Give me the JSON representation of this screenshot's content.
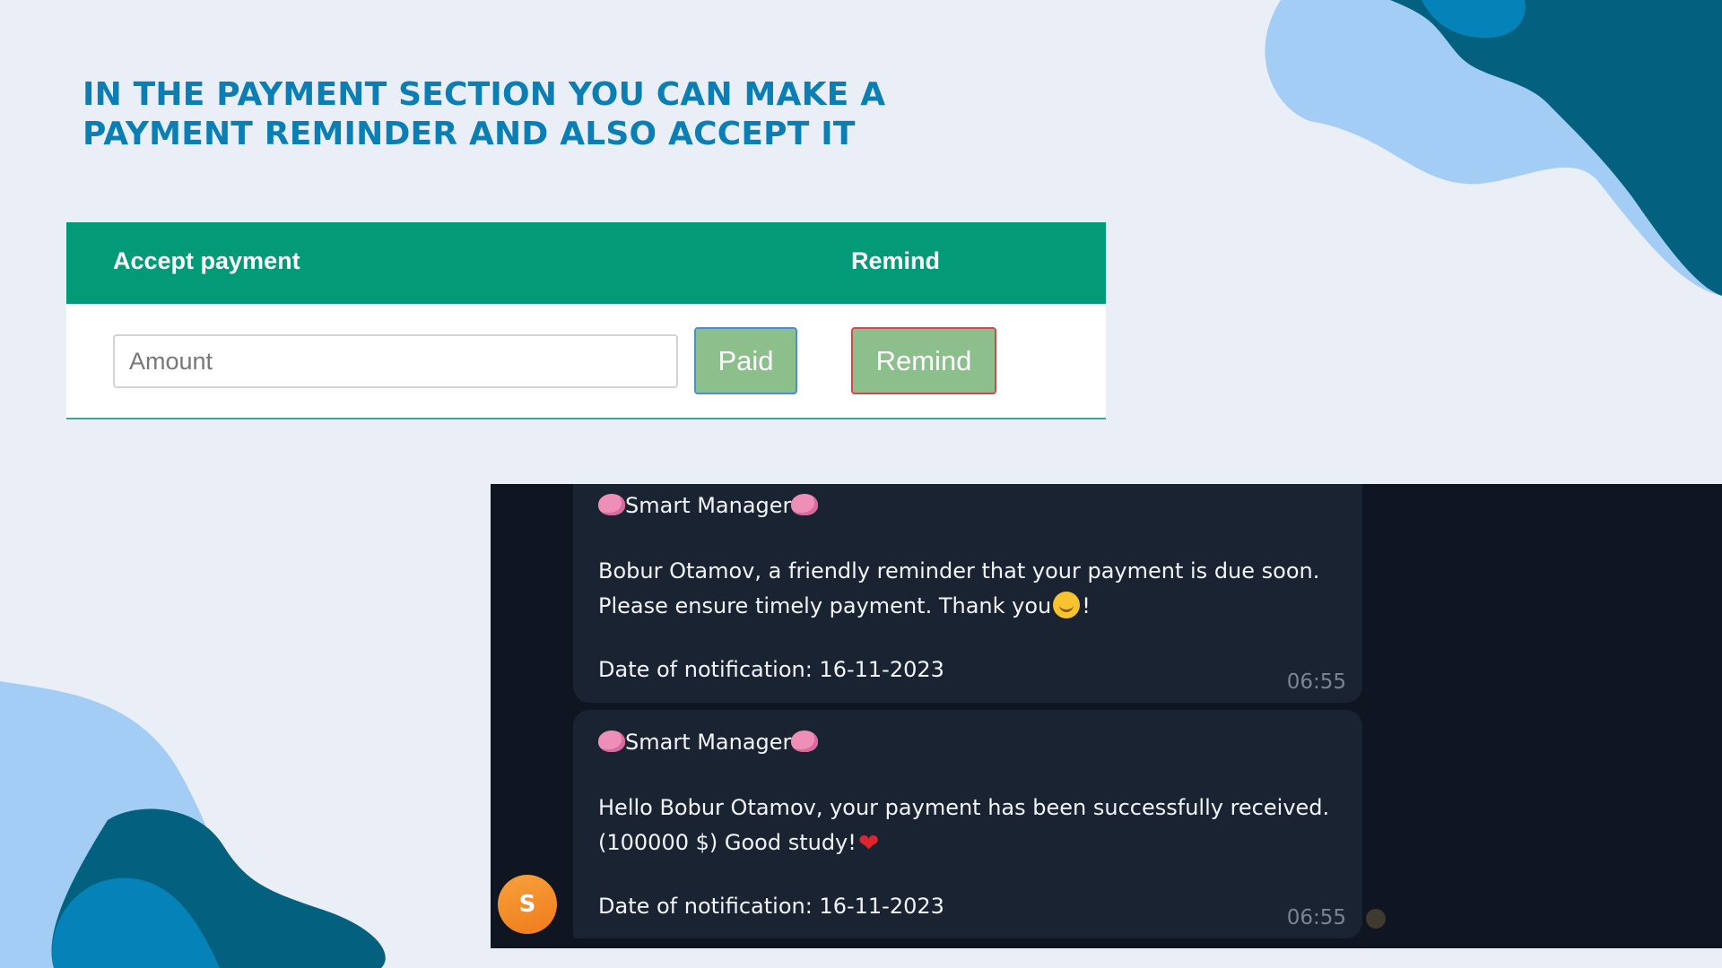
{
  "heading": {
    "line1": "IN THE PAYMENT SECTION YOU CAN MAKE A",
    "line2": "PAYMENT REMINDER AND ALSO ACCEPT IT"
  },
  "payment_table": {
    "col_accept": "Accept payment",
    "col_remind": "Remind",
    "amount_placeholder": "Amount",
    "paid_label": "Paid",
    "remind_label": "Remind"
  },
  "chat": {
    "messages": [
      {
        "sender": "Smart Manager",
        "line1": "Bobur Otamov, a friendly reminder that your payment is due soon.",
        "line2": "Please ensure timely payment. Thank you",
        "line2_suffix": "!",
        "date_line": "Date of notification: 16-11-2023",
        "time": "06:55"
      },
      {
        "sender": "Smart Manager",
        "line1": "Hello Bobur Otamov, your payment has been successfully received.",
        "line2": "(100000 $) Good study!",
        "date_line": "Date of notification: 16-11-2023",
        "time": "06:55"
      }
    ],
    "avatar_letter": "S"
  },
  "colors": {
    "heading": "#0b7fb3",
    "table_header": "#039a78",
    "button_fill": "#8dbf8d",
    "paid_border": "#4a8fd6",
    "remind_border": "#d04a4a",
    "chat_bg": "#0f1521",
    "bubble_bg": "#1a2331",
    "avatar": "#f28c28"
  }
}
